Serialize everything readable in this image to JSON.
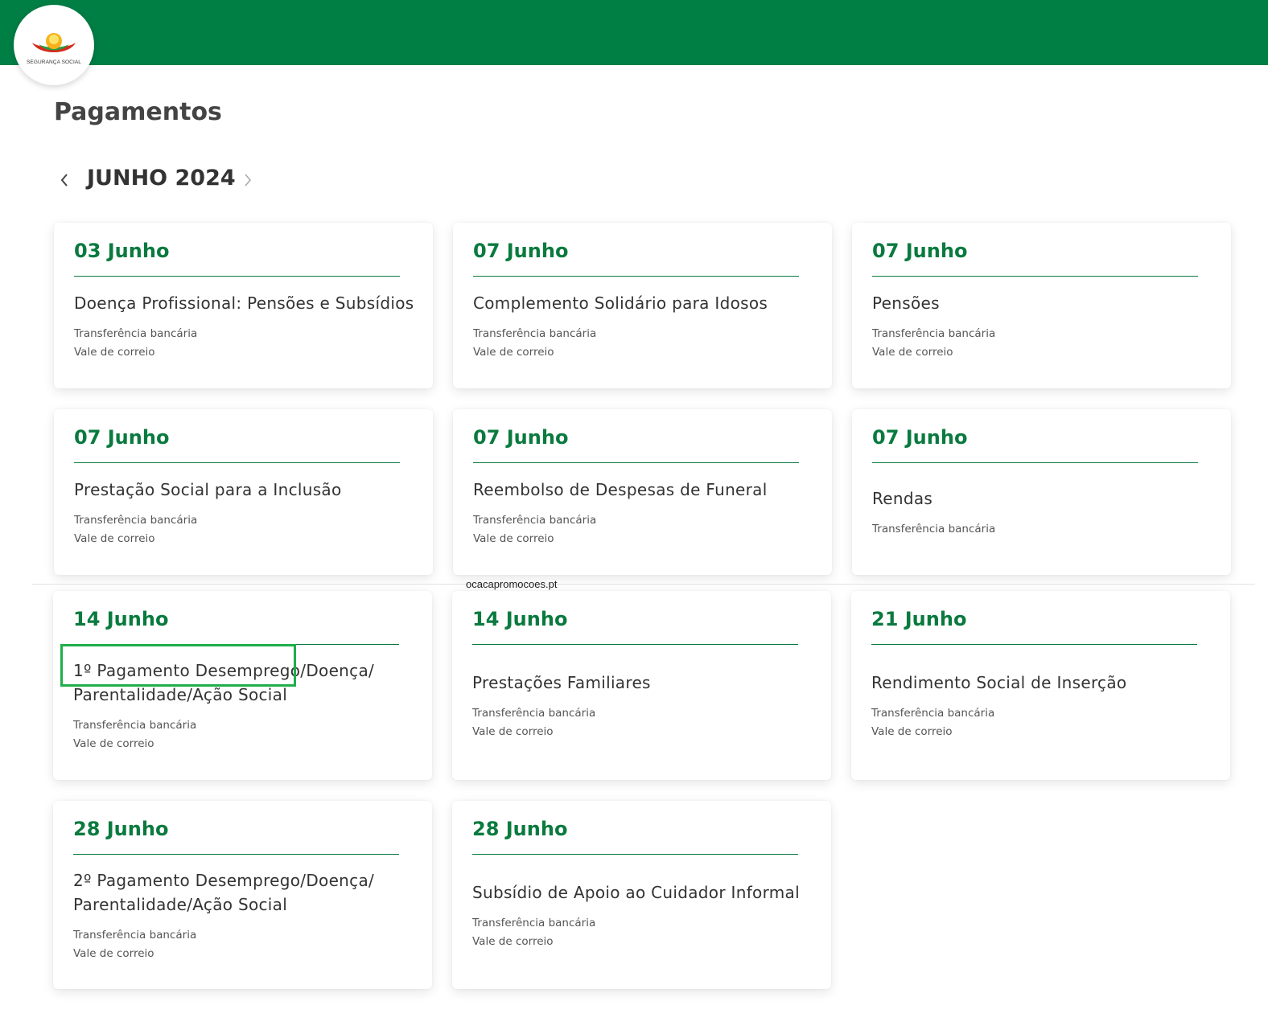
{
  "header": {
    "brand_color": "#007f45",
    "logo_text": "SEGURANÇA SOCIAL"
  },
  "page_title": "Pagamentos",
  "month_nav": {
    "label": "JUNHO 2024",
    "prev_icon": "chevron-left-icon",
    "next_icon": "chevron-right-icon"
  },
  "cards": [
    {
      "date": "03 Junho",
      "title": "Doença Profissional: Pensões e Subsídios",
      "methods": [
        "Transferência bancária",
        "Vale de correio"
      ]
    },
    {
      "date": "07 Junho",
      "title": "Complemento Solidário para Idosos",
      "methods": [
        "Transferência bancária",
        "Vale de correio"
      ]
    },
    {
      "date": "07 Junho",
      "title": "Pensões",
      "methods": [
        "Transferência bancária",
        "Vale de correio"
      ]
    },
    {
      "date": "07 Junho",
      "title": "Prestação Social para a Inclusão",
      "methods": [
        "Transferência bancária",
        "Vale de correio"
      ]
    },
    {
      "date": "07 Junho",
      "title": "Reembolso de Despesas de Funeral",
      "methods": [
        "Transferência bancária",
        "Vale de correio"
      ]
    },
    {
      "date": "07 Junho",
      "title": "Rendas",
      "methods": [
        "Transferência bancária"
      ]
    },
    {
      "date": "14 Junho",
      "title": "1º Pagamento Desemprego/Doença/ Parentalidade/Ação Social",
      "methods": [
        "Transferência bancária",
        "Vale de correio"
      ]
    },
    {
      "date": "14 Junho",
      "title": "Prestações Familiares",
      "methods": [
        "Transferência bancária",
        "Vale de correio"
      ]
    },
    {
      "date": "21 Junho",
      "title": "Rendimento Social de Inserção",
      "methods": [
        "Transferência bancária",
        "Vale de correio"
      ]
    },
    {
      "date": "28 Junho",
      "title": "2º Pagamento Desemprego/Doença/ Parentalidade/Ação Social",
      "methods": [
        "Transferência bancária",
        "Vale de correio"
      ]
    },
    {
      "date": "28 Junho",
      "title": "Subsídio de Apoio ao Cuidador Informal",
      "methods": [
        "Transferência bancária",
        "Vale de correio"
      ]
    }
  ],
  "watermark": "ocacapromocoes.pt",
  "colors": {
    "accent_green": "#0a7a3f",
    "highlight": "#1fae4a"
  }
}
